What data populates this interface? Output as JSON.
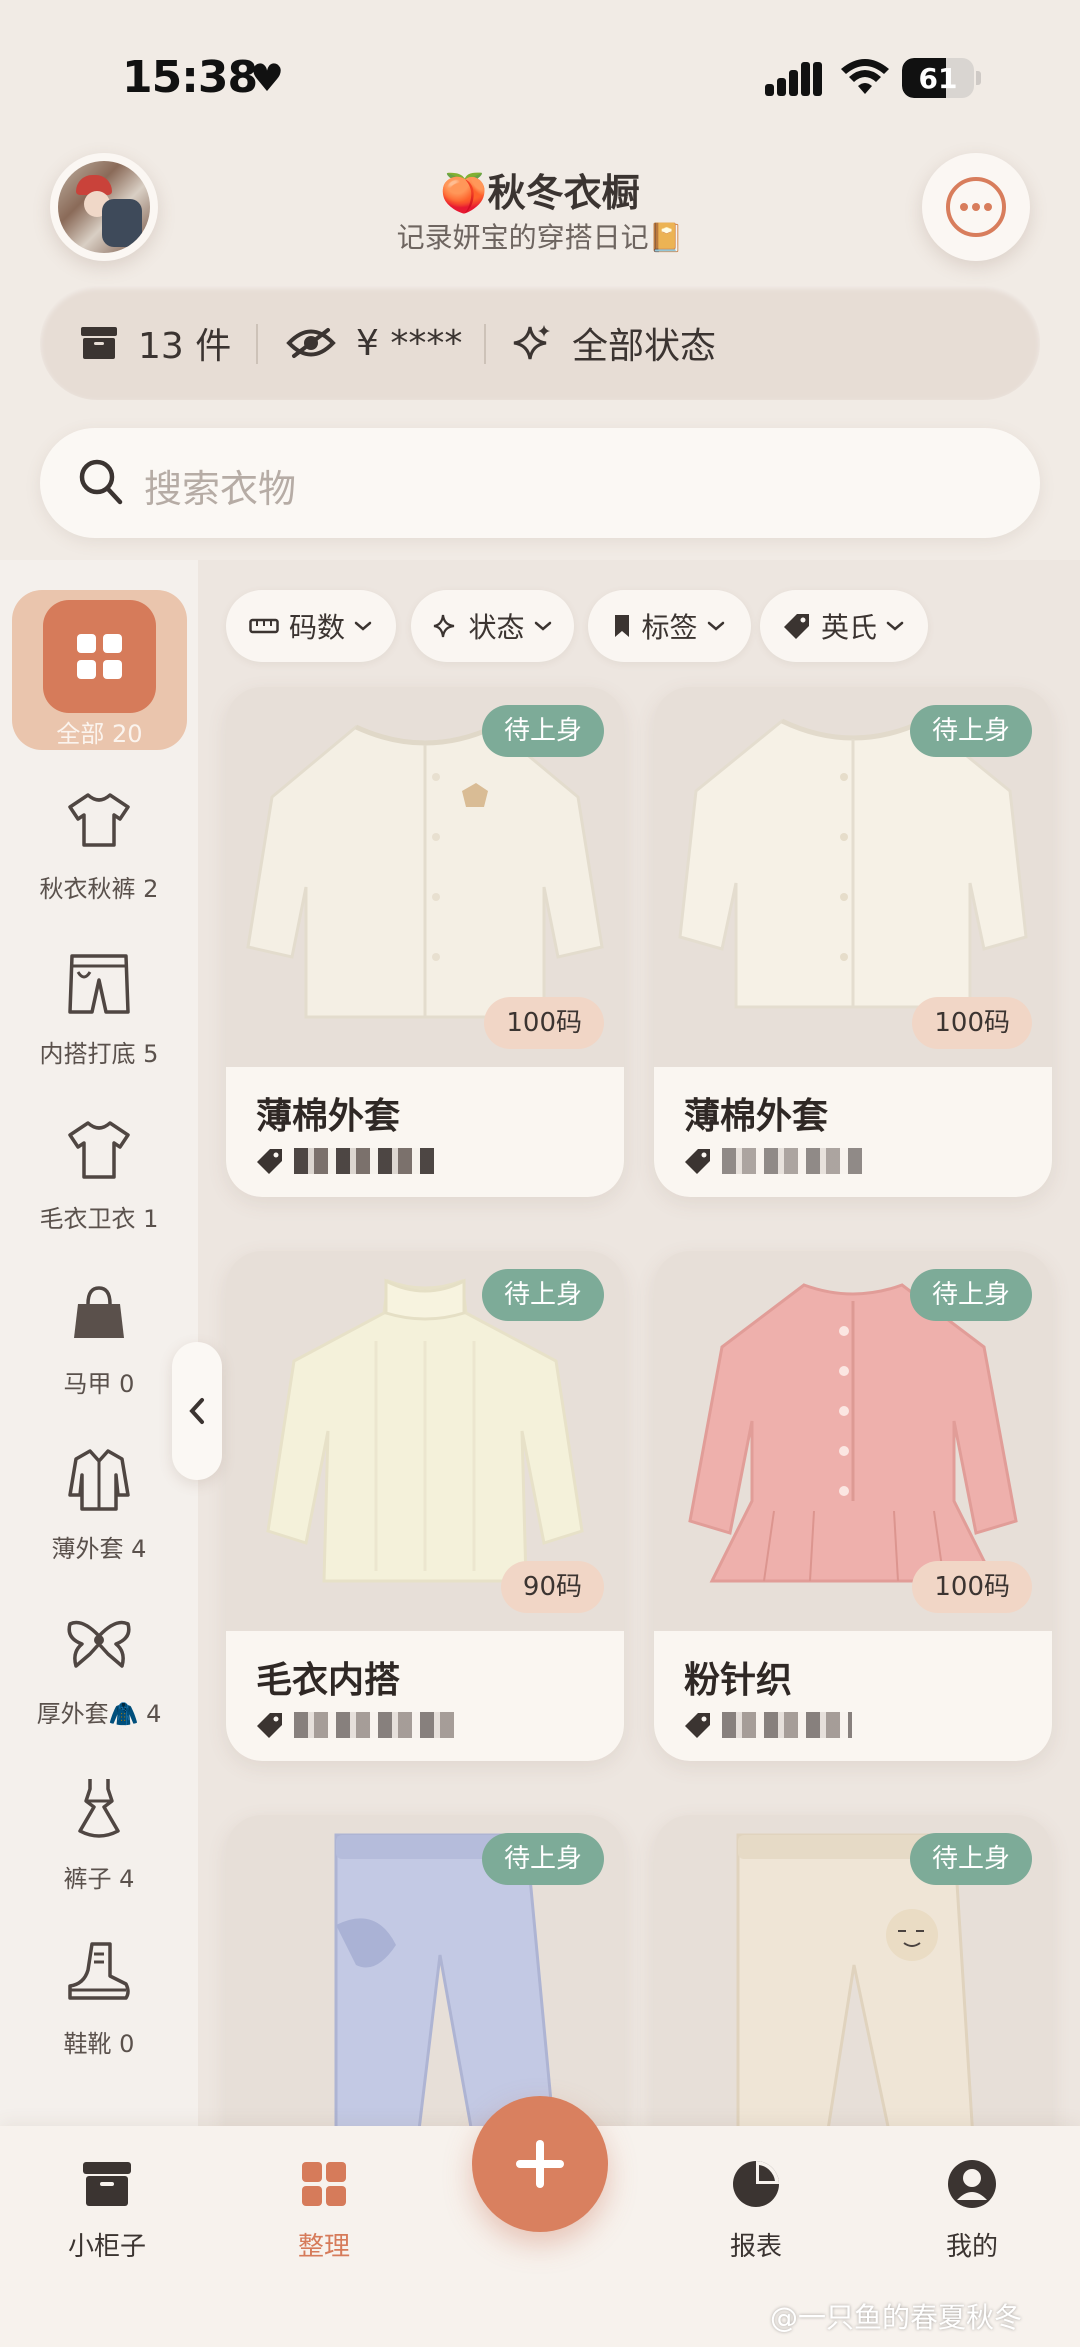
{
  "status_bar": {
    "time": "15:38",
    "battery": "61",
    "battery_level": 0.61
  },
  "header": {
    "title": "🍑秋冬衣橱",
    "subtitle": "记录妍宝的穿搭日记📔"
  },
  "stats": {
    "count": "13 件",
    "price": "¥ ****",
    "status": "全部状态"
  },
  "search": {
    "placeholder": "搜索衣物"
  },
  "sidebar": {
    "active": {
      "label": "全部 20"
    },
    "items": [
      {
        "label": "秋衣秋裤 2",
        "icon": "tshirt-icon"
      },
      {
        "label": "内搭打底 5",
        "icon": "shorts-icon"
      },
      {
        "label": "毛衣卫衣 1",
        "icon": "tshirt-icon"
      },
      {
        "label": "马甲 0",
        "icon": "bag-icon"
      },
      {
        "label": "薄外套 4",
        "icon": "coat-icon"
      },
      {
        "label": "厚外套🧥 4",
        "icon": "bow-icon"
      },
      {
        "label": "裤子 4",
        "icon": "dress-icon"
      },
      {
        "label": "鞋靴 0",
        "icon": "boot-icon"
      }
    ]
  },
  "filters": [
    {
      "label": "码数",
      "icon": "ruler-icon"
    },
    {
      "label": "状态",
      "icon": "sparkle-icon"
    },
    {
      "label": "标签",
      "icon": "bookmark-icon"
    },
    {
      "label": "英氏",
      "icon": "tag-icon"
    }
  ],
  "cards": [
    {
      "name": "薄棉外套",
      "status": "待上身",
      "size": "100码",
      "item": "cream-jacket"
    },
    {
      "name": "薄棉外套",
      "status": "待上身",
      "size": "100码",
      "item": "cream-jacket"
    },
    {
      "name": "毛衣内搭",
      "status": "待上身",
      "size": "90码",
      "item": "cream-sweater"
    },
    {
      "name": "粉针织",
      "status": "待上身",
      "size": "100码",
      "item": "pink-cardigan"
    },
    {
      "name": "",
      "status": "待上身",
      "size": "",
      "item": "blue-pants"
    },
    {
      "name": "",
      "status": "待上身",
      "size": "",
      "item": "beige-pants"
    }
  ],
  "tabbar": {
    "tabs": [
      {
        "label": "小柜子",
        "icon": "box-icon"
      },
      {
        "label": "整理",
        "icon": "grid-icon"
      },
      {
        "label": "报表",
        "icon": "pie-chart-icon"
      },
      {
        "label": "我的",
        "icon": "user-icon"
      }
    ],
    "add_label": "+"
  },
  "watermark": "@一只鱼的春夏秋冬",
  "colors": {
    "accent": "#d67b5a",
    "status_green": "#7dab98",
    "size_peach": "#f1d6c6",
    "background": "#f1ebe5"
  }
}
